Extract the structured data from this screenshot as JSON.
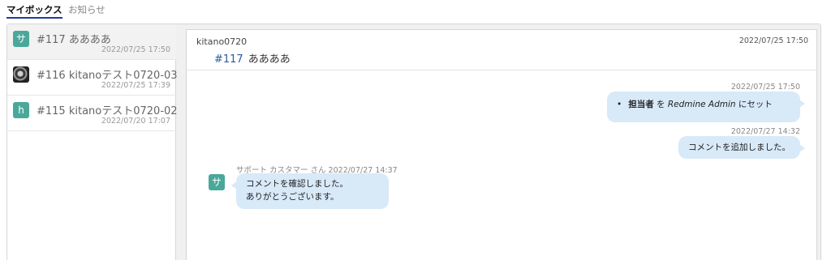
{
  "tabs": [
    {
      "label": "マイボックス",
      "active": true
    },
    {
      "label": "お知らせ",
      "active": false
    }
  ],
  "tickets": [
    {
      "avatar": "サ",
      "avatar_type": "letter",
      "title": "#117 ああああ",
      "date": "2022/07/25 17:50",
      "selected": true
    },
    {
      "avatar": "",
      "avatar_type": "image",
      "title": "#116 kitanoテスト0720-03",
      "date": "2022/07/25 17:39",
      "selected": false
    },
    {
      "avatar": "h",
      "avatar_type": "letter",
      "title": "#115 kitanoテスト0720-02",
      "date": "2022/07/20 17:07",
      "selected": false
    }
  ],
  "header": {
    "author": "kitano0720",
    "date": "2022/07/25 17:50",
    "subject_number": "#117",
    "subject_text": "ああああ"
  },
  "messages": [
    {
      "side": "right",
      "date": "2022/07/25 17:50",
      "change": {
        "field": "担当者",
        "particle": "を",
        "value": "Redmine Admin",
        "suffix": "にセット"
      }
    },
    {
      "side": "right",
      "date": "2022/07/27 14:32",
      "text": "コメントを追加しました。"
    },
    {
      "side": "left",
      "avatar": "サ",
      "meta": "サポート カスタマー さん 2022/07/27 14:37",
      "line1": "コメントを確認しました。",
      "line2": "ありがとうございます。"
    }
  ],
  "colors": {
    "accent_underline": "#1f3c9e",
    "avatar_bg": "#4aa89a",
    "bubble_bg": "#d8e9f8",
    "link": "#2a5d9f"
  }
}
